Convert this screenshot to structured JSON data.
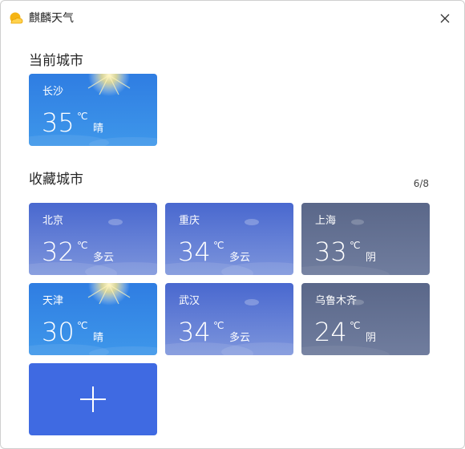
{
  "app": {
    "title": "麒麟天气"
  },
  "current_section": {
    "title": "当前城市",
    "card": {
      "city": "长沙",
      "temp": "35",
      "unit": "℃",
      "condition": "晴"
    }
  },
  "favorites_section": {
    "title": "收藏城市",
    "counter": "6/8",
    "cards": [
      {
        "city": "北京",
        "temp": "32",
        "unit": "℃",
        "condition": "多云"
      },
      {
        "city": "重庆",
        "temp": "34",
        "unit": "℃",
        "condition": "多云"
      },
      {
        "city": "上海",
        "temp": "33",
        "unit": "℃",
        "condition": "阴"
      },
      {
        "city": "天津",
        "temp": "30",
        "unit": "℃",
        "condition": "晴"
      },
      {
        "city": "武汉",
        "temp": "34",
        "unit": "℃",
        "condition": "多云"
      },
      {
        "city": "乌鲁木齐",
        "temp": "24",
        "unit": "℃",
        "condition": "阴"
      }
    ],
    "add_icon": "plus-icon"
  },
  "colors": {
    "sunny": "#2f7de2",
    "cloudy": "#4968cf",
    "overcast": "#5a6789",
    "add": "#3f6ae2"
  }
}
